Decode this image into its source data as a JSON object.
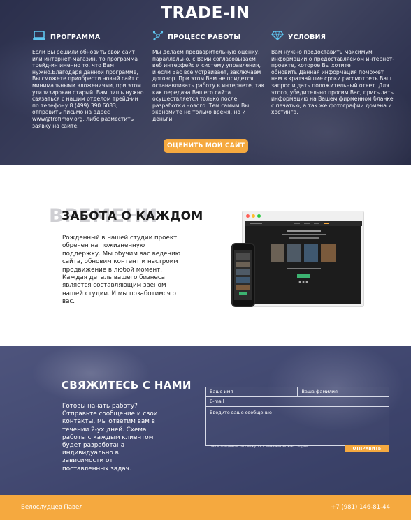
{
  "hero": {
    "title": "TRADE-IN",
    "button_label": "ОЦЕНИТЬ МОЙ САЙТ",
    "columns": [
      {
        "icon": "laptop-icon",
        "heading": "ПРОГРАММА",
        "text": "Если Вы решили обновить свой сайт или интернет-магазин, то программа трейд-ин именно то, что Вам нужно.Благодаря данной программе, Вы сможете приобрести новый сайт с минимальными вложениями, при этом утилизировав старый. Вам лишь нужно связаться с нашим отделом трейд-ин по телефону 8 (499) 390 6083, отправить письмо на адрес www@trofimov.org, либо разместить заявку на сайте."
      },
      {
        "icon": "network-icon",
        "heading": "ПРОЦЕСС РАБОТЫ",
        "text": "Мы делаем предварительную оценку, параллельно, с Вами согласовываем веб интерфейс и систему управления, и если Вас все устраивает, заключаем договор. При этом Вам не придется останавливать работу в интернете, так как передача Вашего сайта осуществляется только после разработки нового. Тем самым Вы экономите не только время, но и деньги."
      },
      {
        "icon": "diamond-icon",
        "heading": "УСЛОВИЯ",
        "text": "Вам нужно предоставить максимум информации о предоставляемом интернет-проекте, которое Вы хотите обновить.Данная информация поможет нам в кратчайшие сроки рассмотреть Ваш запрос и дать положительный ответ. Для этого, убедительно просим Вас, присылать информацию на Вашем фирменном бланке с печатью, а так же фотографии домена и хостинга."
      }
    ]
  },
  "care": {
    "ghost_text": "ВРЕМЕНИ",
    "title": "ЗАБОТА О КАЖДОМ",
    "text": "Рожденный в нашей студии проект обречен на пожизненную поддержку. Мы обучим вас ведению сайта, обновим контент и настроим продвижение в любой момент. Каждая деталь вашего бизнеса является составляющим звеном нашей студии. И мы позаботимся о вас."
  },
  "contact": {
    "title": "СВЯЖИТЕСЬ С НАМИ",
    "text": "Готовы начать работу? Отправьте сообщение и свои контакты, мы ответим вам в течении 2-ух дней. Схема работы с каждым клиентом будет разработана индивидуально в зависимости от поставленных задач.",
    "form": {
      "name_placeholder": "Ваше имя",
      "surname_placeholder": "Ваша фамилия",
      "email_placeholder": "E-mail",
      "message_placeholder": "Введите ваше сообщение",
      "note": "Наши специалисты свяжутся с вами как можно скорее",
      "submit_label": "ОТПРАВИТЬ"
    }
  },
  "footer": {
    "name": "Белослудцев Павел",
    "phone": "+7 (981) 146-81-44"
  },
  "colors": {
    "accent": "#f5a93f",
    "hero_overlay": "#2f3450",
    "contact_overlay": "#4b5277"
  }
}
